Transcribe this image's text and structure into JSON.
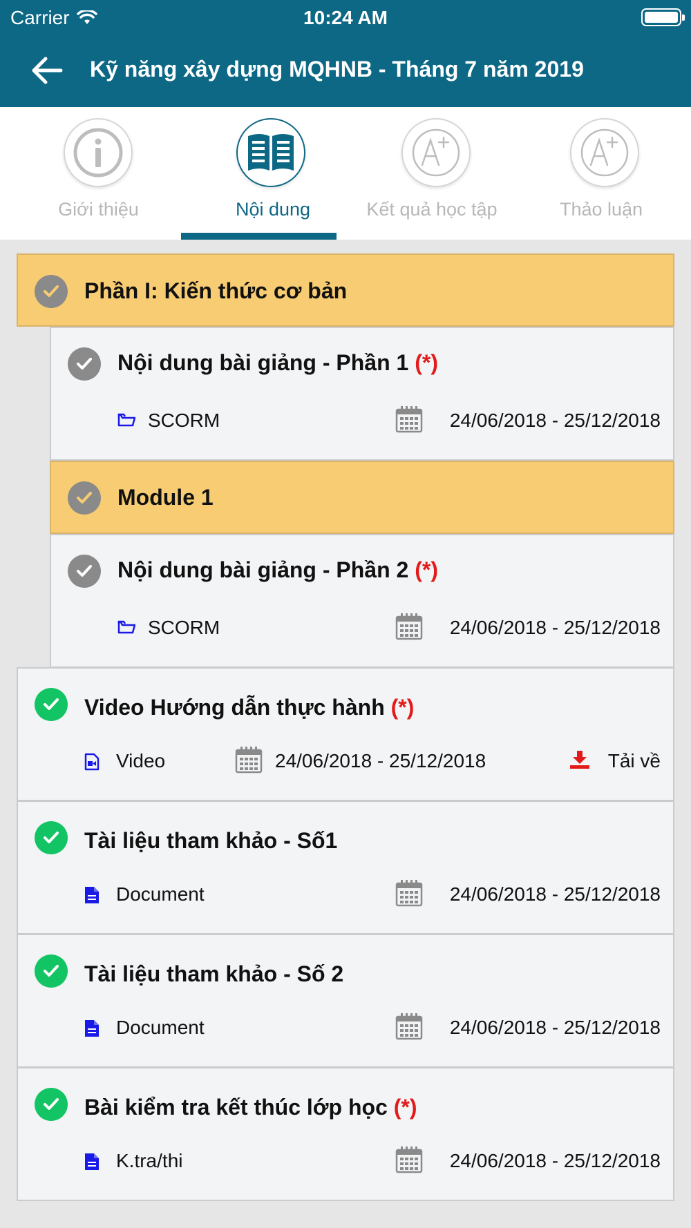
{
  "status_bar": {
    "carrier": "Carrier",
    "time": "10:24 AM"
  },
  "nav": {
    "title": "Kỹ năng xây dựng MQHNB - Tháng 7 năm 2019"
  },
  "tabs": [
    {
      "label": "Giới thiệu",
      "icon": "info-icon",
      "active": false
    },
    {
      "label": "Nội dung",
      "icon": "book-icon",
      "active": true
    },
    {
      "label": "Kết quả học tập",
      "icon": "grade-icon",
      "active": false
    },
    {
      "label": "Thảo luận",
      "icon": "grade-icon",
      "active": false
    }
  ],
  "required_mark": "(*)",
  "items": [
    {
      "kind": "section",
      "title": "Phần I: Kiến thức cơ bản",
      "status": "completed-gray"
    },
    {
      "kind": "lesson",
      "title": "Nội dung bài giảng - Phần 1",
      "required": true,
      "type_label": "SCORM",
      "type_icon": "folder-icon",
      "dates": "24/06/2018 - 25/12/2018",
      "status": "completed-gray"
    },
    {
      "kind": "section",
      "title": "Module 1",
      "status": "completed-gray"
    },
    {
      "kind": "lesson",
      "title": "Nội dung bài giảng - Phần 2",
      "required": true,
      "type_label": "SCORM",
      "type_icon": "folder-icon",
      "dates": "24/06/2018 - 25/12/2018",
      "status": "completed-gray"
    },
    {
      "kind": "lesson",
      "title": "Video Hướng dẫn thực hành",
      "required": true,
      "type_label": "Video",
      "type_icon": "video-file-icon",
      "dates": "24/06/2018 - 25/12/2018",
      "download_label": "Tải về",
      "status": "completed-green"
    },
    {
      "kind": "lesson",
      "title": "Tài liệu tham khảo - Số1",
      "required": false,
      "type_label": "Document",
      "type_icon": "document-icon",
      "dates": "24/06/2018 - 25/12/2018",
      "status": "completed-green"
    },
    {
      "kind": "lesson",
      "title": "Tài liệu tham khảo - Số 2",
      "required": false,
      "type_label": "Document",
      "type_icon": "document-icon",
      "dates": "24/06/2018 - 25/12/2018",
      "status": "completed-green"
    },
    {
      "kind": "lesson",
      "title": "Bài kiểm tra kết thúc lớp học",
      "required": true,
      "type_label": "K.tra/thi",
      "type_icon": "document-icon",
      "dates": "24/06/2018 - 25/12/2018",
      "status": "completed-green"
    }
  ],
  "colors": {
    "primary": "#0d6886",
    "section": "#f7cc72",
    "done_green": "#12c463",
    "done_gray": "#8a8a8a",
    "required": "#e31a1a",
    "type_icon": "#1a1ae6"
  }
}
